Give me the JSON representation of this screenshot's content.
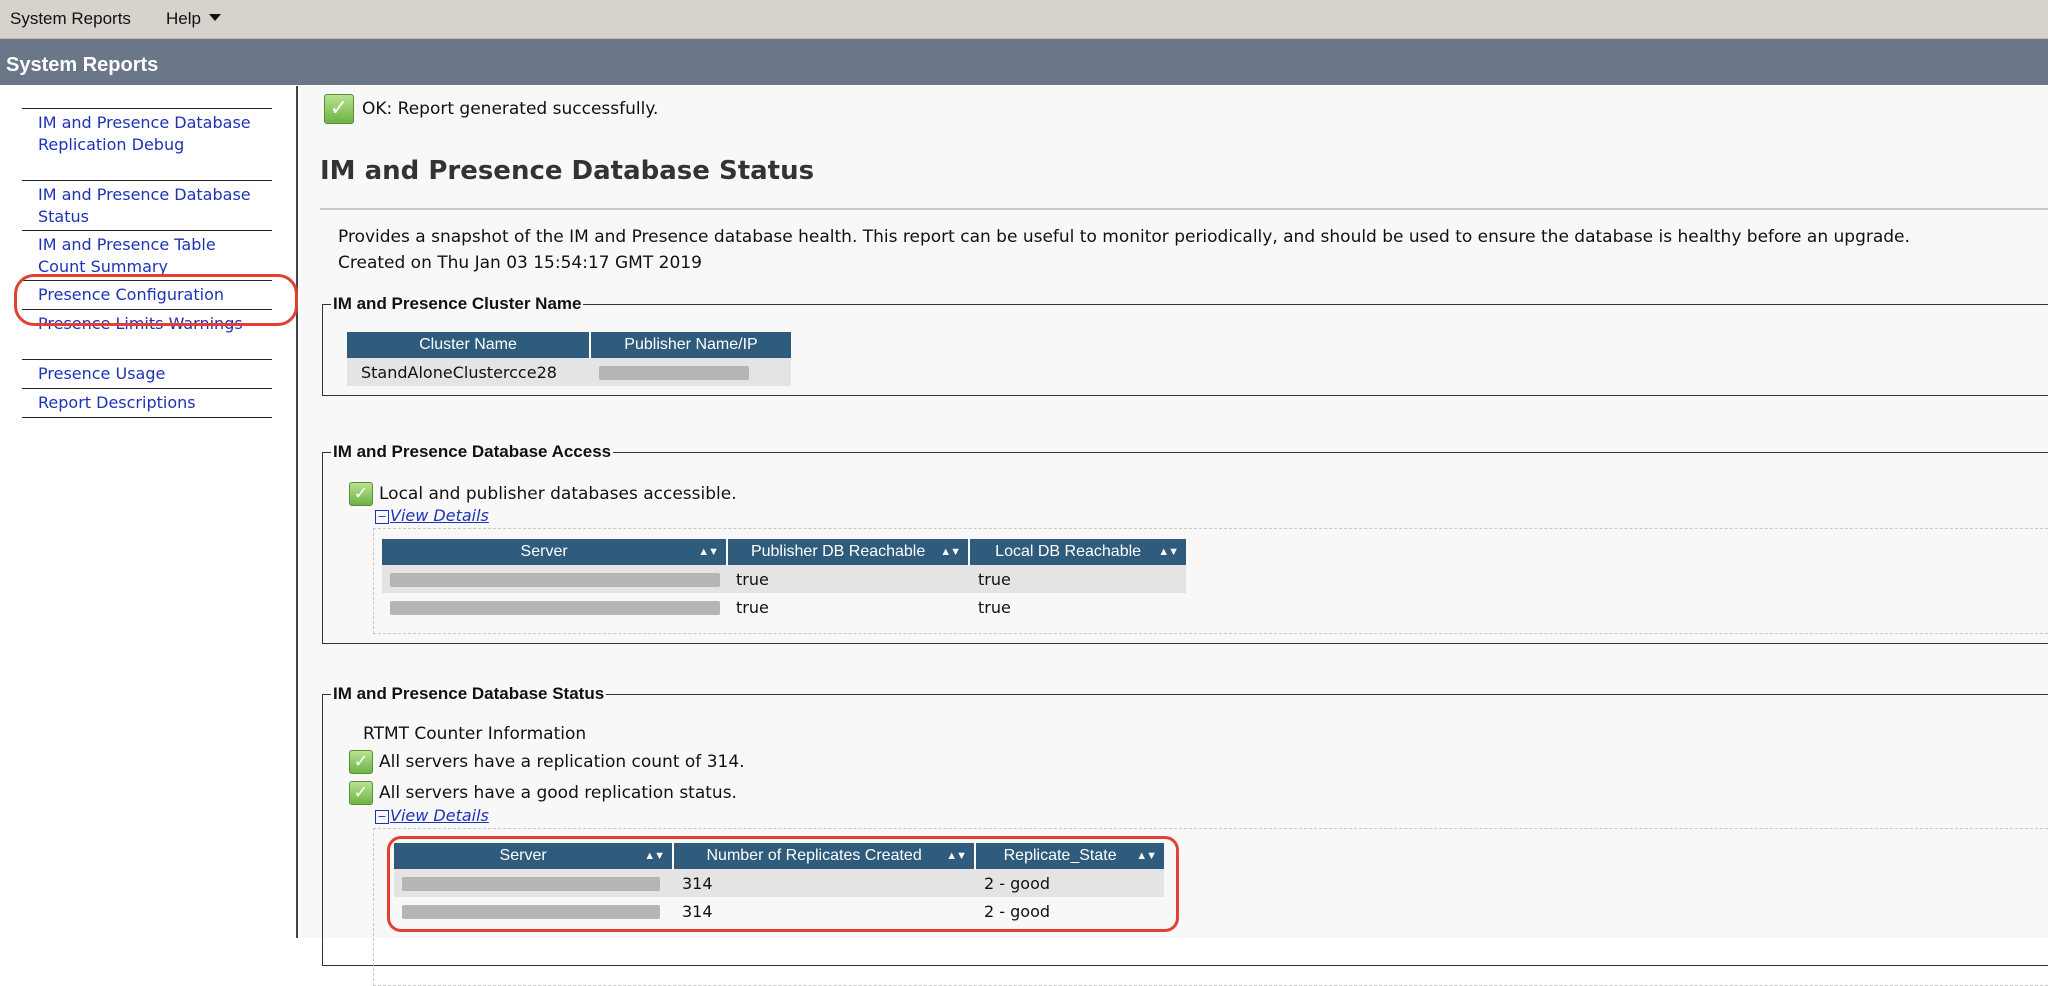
{
  "menubar": {
    "items": [
      "System Reports",
      "Help"
    ]
  },
  "titlebar": {
    "title": "System Reports"
  },
  "sidebar": {
    "items": [
      {
        "label": "IM and Presence Database Replication Debug"
      },
      {
        "label": "IM and Presence Database Status"
      },
      {
        "label": "IM and Presence Table Count Summary"
      },
      {
        "label": "Presence Configuration"
      },
      {
        "label": "Presence Limits Warnings"
      },
      {
        "label": "Presence Usage"
      },
      {
        "label": "Report Descriptions"
      }
    ]
  },
  "main": {
    "ok_message": "OK: Report generated successfully.",
    "title": "IM and Presence Database Status",
    "description": "Provides a snapshot of the IM and Presence database health. This report can be useful to monitor periodically, and should be used to ensure the database is healthy before an upgrade.",
    "created": "Created on Thu Jan 03 15:54:17 GMT 2019",
    "cluster": {
      "legend": "IM and Presence Cluster Name",
      "headers": [
        "Cluster Name",
        "Publisher Name/IP"
      ],
      "rows": [
        [
          "StandAloneClustercce28",
          ""
        ]
      ]
    },
    "access": {
      "legend": "IM and Presence Database Access",
      "status": "Local and publisher databases accessible.",
      "view_details": "View Details",
      "headers": [
        "Server",
        "Publisher DB Reachable",
        "Local DB Reachable"
      ],
      "rows": [
        [
          "",
          "true",
          "true"
        ],
        [
          "",
          "true",
          "true"
        ]
      ]
    },
    "db_status": {
      "legend": "IM and Presence Database Status",
      "rtmt_label": "RTMT Counter Information",
      "status1": "All servers have a replication count of 314.",
      "status2": "All servers have a good replication status.",
      "view_details": "View Details",
      "headers": [
        "Server",
        "Number of Replicates Created",
        "Replicate_State"
      ],
      "rows": [
        [
          "",
          "314",
          "2 - good"
        ],
        [
          "",
          "314",
          "2 - good"
        ]
      ]
    }
  },
  "colors": {
    "header_bg": "#6b7789",
    "table_header": "#2f5b7c",
    "link": "#1d33b6",
    "highlight": "#e04130"
  }
}
